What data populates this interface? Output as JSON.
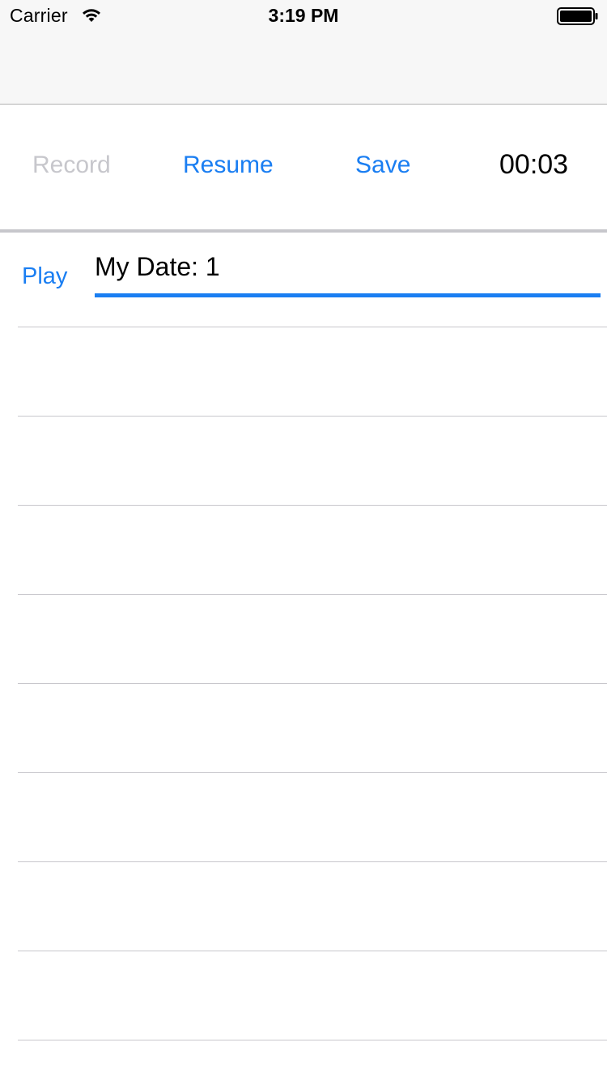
{
  "status_bar": {
    "carrier": "Carrier",
    "time": "3:19 PM",
    "wifi_icon": "wifi-icon",
    "battery_icon": "battery-icon"
  },
  "toolbar": {
    "record_label": "Record",
    "resume_label": "Resume",
    "save_label": "Save",
    "timer": "00:03"
  },
  "list": {
    "play_label": "Play",
    "date_value": "My Date: 1",
    "empty_rows": 8
  },
  "colors": {
    "accent": "#1a7ef2",
    "disabled": "#c7c7cc",
    "separator": "#c8c7cc",
    "bar_background": "#f7f7f7"
  }
}
